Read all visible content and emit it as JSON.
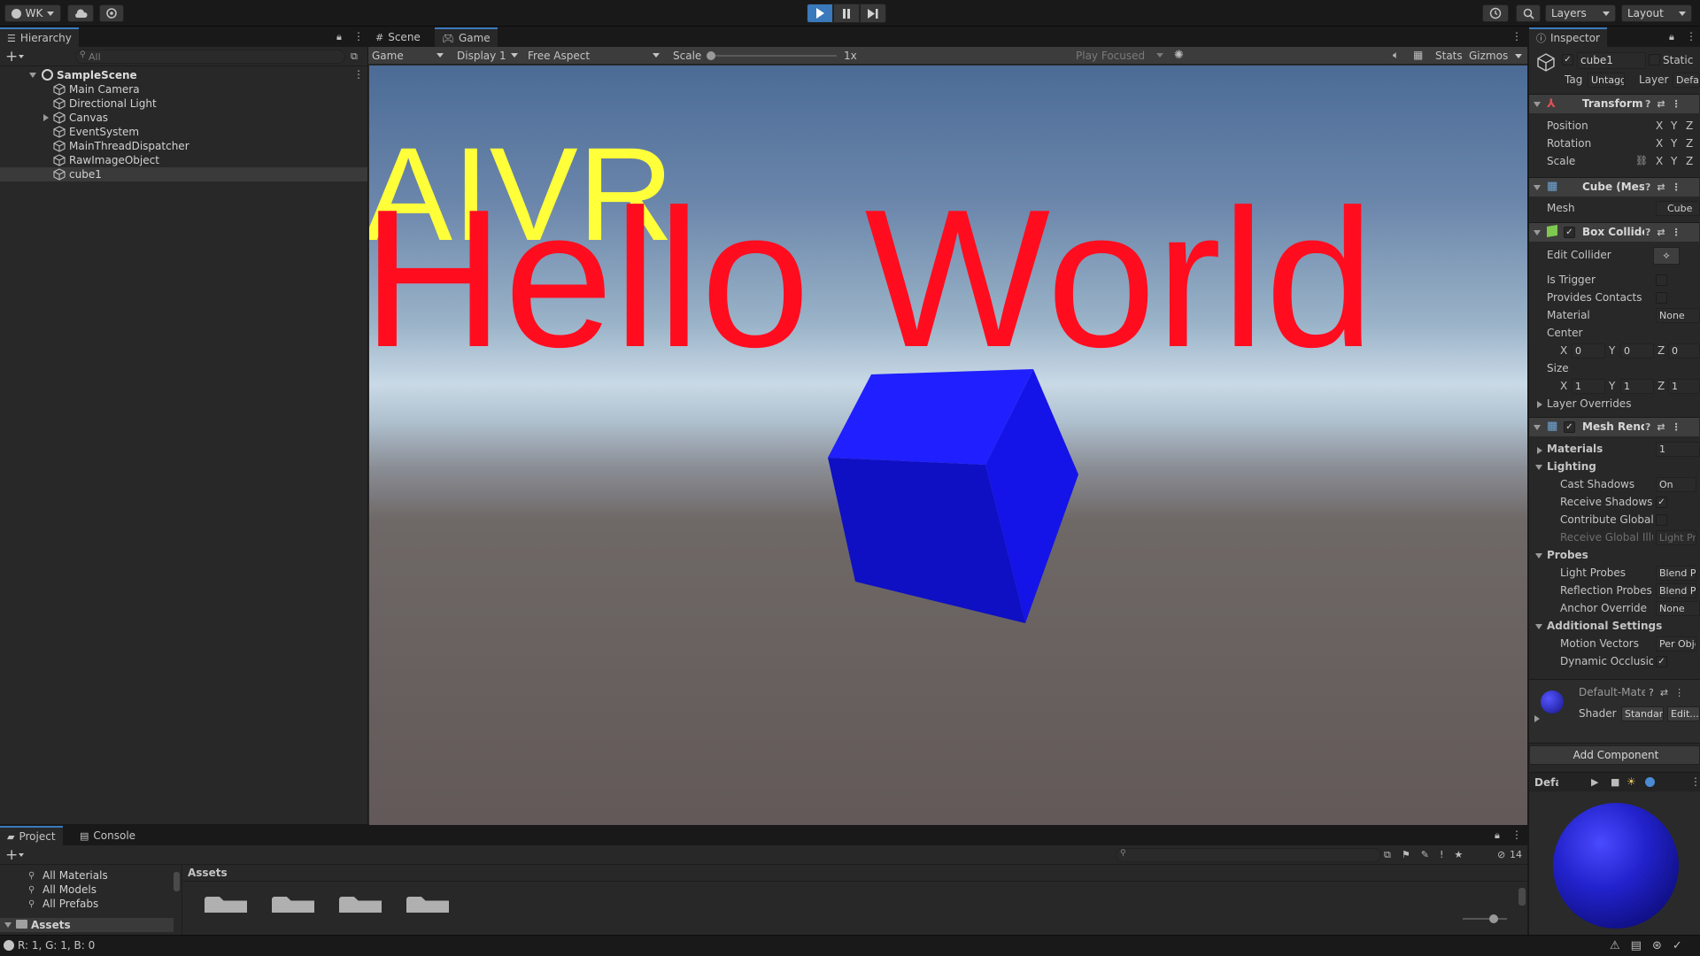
{
  "toolbar": {
    "account_label": "WK",
    "layers_label": "Layers",
    "layout_label": "Layout"
  },
  "hierarchy": {
    "tab_label": "Hierarchy",
    "search_placeholder": "All",
    "scene_name": "SampleScene",
    "items": [
      {
        "label": "Main Camera"
      },
      {
        "label": "Directional Light"
      },
      {
        "label": "Canvas"
      },
      {
        "label": "EventSystem"
      },
      {
        "label": "MainThreadDispatcher"
      },
      {
        "label": "RawImageObject"
      },
      {
        "label": "cube1"
      }
    ]
  },
  "viewport": {
    "tabs": [
      {
        "label": "Scene"
      },
      {
        "label": "Game"
      }
    ],
    "game_dropdown": "Game",
    "display_dropdown": "Display 1",
    "aspect_dropdown": "Free Aspect",
    "scale_label": "Scale",
    "scale_value": "1x",
    "play_focused": "Play Focused",
    "stats_label": "Stats",
    "gizmos_label": "Gizmos",
    "text_aivr": "AIVR",
    "text_hello": "Hello World",
    "colors": {
      "aivr": "#ffff3a",
      "hello": "#ff0d1f",
      "cube": "#1a1aff"
    }
  },
  "inspector": {
    "tab_label": "Inspector",
    "object_name": "cube1",
    "static_label": "Static",
    "tag_label": "Tag",
    "tag_value": "Untagged",
    "layer_label": "Layer",
    "layer_value": "Default",
    "transform": {
      "title": "Transform",
      "position": "Position",
      "rotation": "Rotation",
      "scale": "Scale",
      "x": "X",
      "y": "Y",
      "z": "Z"
    },
    "mesh_filter": {
      "title": "Cube (Mesh Filter)",
      "mesh_label": "Mesh",
      "mesh_value": "Cube"
    },
    "box_collider": {
      "title": "Box Collider",
      "edit_collider": "Edit Collider",
      "is_trigger": "Is Trigger",
      "provides_contacts": "Provides Contacts",
      "material": "Material",
      "material_value": "None",
      "center": "Center",
      "center_x": "0",
      "center_y": "0",
      "center_z": "0",
      "size": "Size",
      "size_x": "1",
      "size_y": "1",
      "size_z": "1",
      "layer_overrides": "Layer Overrides"
    },
    "mesh_renderer": {
      "title": "Mesh Renderer",
      "materials": "Materials",
      "materials_count": "1",
      "lighting": "Lighting",
      "cast_shadows": "Cast Shadows",
      "cast_shadows_value": "On",
      "receive_shadows": "Receive Shadows",
      "contribute_gi": "Contribute Global Illumination",
      "receive_gi": "Receive Global Illumination",
      "receive_gi_value": "Light Probes",
      "probes": "Probes",
      "light_probes": "Light Probes",
      "light_probes_value": "Blend Probes",
      "reflection_probes": "Reflection Probes",
      "reflection_probes_value": "Blend Probes",
      "anchor_override": "Anchor Override",
      "anchor_override_value": "None",
      "additional_settings": "Additional Settings",
      "motion_vectors": "Motion Vectors",
      "motion_vectors_value": "Per Object Motion",
      "dynamic_occlusion": "Dynamic Occlusion"
    },
    "material": {
      "name": "Default-Material",
      "shader_label": "Shader",
      "shader_value": "Standard",
      "edit_label": "Edit..."
    },
    "add_component": "Add Component",
    "preview_label": "Default-Material"
  },
  "project": {
    "tabs": [
      {
        "label": "Project"
      },
      {
        "label": "Console"
      }
    ],
    "favorites": [
      {
        "label": "All Materials"
      },
      {
        "label": "All Models"
      },
      {
        "label": "All Prefabs"
      }
    ],
    "assets_tree_label": "Assets",
    "breadcrumb": "Assets",
    "hidden_count": "14"
  },
  "status": {
    "text": "R: 1, G: 1, B: 0"
  }
}
